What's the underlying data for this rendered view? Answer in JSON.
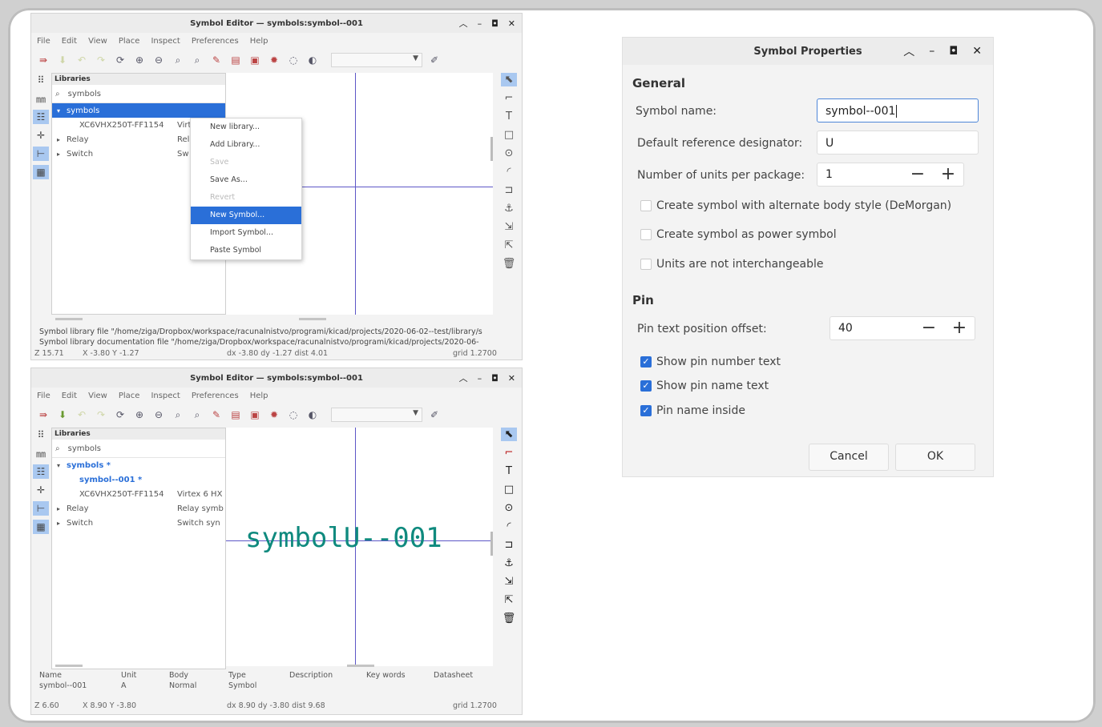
{
  "top_window": {
    "title": "Symbol Editor — symbols:symbol--001",
    "menu": [
      "File",
      "Edit",
      "View",
      "Place",
      "Inspect",
      "Preferences",
      "Help"
    ],
    "libraries_header": "Libraries",
    "search_value": "symbols",
    "tree": [
      {
        "name": "symbols",
        "desc": "",
        "selected": true,
        "arrow": "▾"
      },
      {
        "name": "XC6VHX250T-FF1154",
        "desc": "Virt",
        "selected": false,
        "arrow": ""
      },
      {
        "name": "Relay",
        "desc": "Rel",
        "selected": false,
        "arrow": "▸"
      },
      {
        "name": "Switch",
        "desc": "Sw",
        "selected": false,
        "arrow": "▸"
      }
    ],
    "context_menu": [
      {
        "label": "New library...",
        "state": "normal"
      },
      {
        "label": "Add Library...",
        "state": "normal"
      },
      {
        "label": "Save",
        "state": "disabled"
      },
      {
        "label": "Save As...",
        "state": "normal"
      },
      {
        "label": "Revert",
        "state": "disabled"
      },
      {
        "label": "New Symbol...",
        "state": "highlight"
      },
      {
        "label": "Import Symbol...",
        "state": "normal"
      },
      {
        "label": "Paste Symbol",
        "state": "normal"
      }
    ],
    "msg1": "Symbol library file \"/home/ziga/Dropbox/workspace/racunalnistvo/programi/kicad/projects/2020-06-02--test/library/s",
    "msg2": "Symbol library documentation file \"/home/ziga/Dropbox/workspace/racunalnistvo/programi/kicad/projects/2020-06-",
    "status": {
      "z": "Z 15.71",
      "xy": "X -3.80  Y -1.27",
      "d": "dx -3.80  dy -1.27  dist 4.01",
      "grid": "grid 1.2700"
    }
  },
  "bottom_window": {
    "title": "Symbol Editor — symbols:symbol--001",
    "menu": [
      "File",
      "Edit",
      "View",
      "Place",
      "Inspect",
      "Preferences",
      "Help"
    ],
    "libraries_header": "Libraries",
    "search_value": "symbols",
    "tree": [
      {
        "name": "symbols *",
        "desc": "",
        "bold": true,
        "arrow": "▾",
        "indent": 0
      },
      {
        "name": "symbol--001 *",
        "desc": "",
        "bold": true,
        "arrow": "",
        "indent": 1
      },
      {
        "name": "XC6VHX250T-FF1154",
        "desc": "Virtex 6 HX",
        "bold": false,
        "arrow": "",
        "indent": 1
      },
      {
        "name": "Relay",
        "desc": "Relay symb",
        "bold": false,
        "arrow": "▸",
        "indent": 0
      },
      {
        "name": "Switch",
        "desc": "Switch syn",
        "bold": false,
        "arrow": "▸",
        "indent": 0
      }
    ],
    "canvas_text": "symbolU--001",
    "info_headers": [
      "Name",
      "Unit",
      "Body",
      "Type",
      "Description",
      "Key words",
      "Datasheet"
    ],
    "info_values": [
      "symbol--001",
      "A",
      "Normal",
      "Symbol",
      "",
      "",
      ""
    ],
    "status": {
      "z": "Z 6.60",
      "xy": "X 8.90  Y -3.80",
      "d": "dx 8.90  dy -3.80  dist 9.68",
      "grid": "grid 1.2700"
    }
  },
  "props": {
    "title": "Symbol Properties",
    "general": "General",
    "name_label": "Symbol name:",
    "name_value": "symbol--001",
    "ref_label": "Default reference designator:",
    "ref_value": "U",
    "units_label": "Number of units per package:",
    "units_value": "1",
    "chk_demorgan": "Create symbol with alternate body style (DeMorgan)",
    "chk_power": "Create symbol as power symbol",
    "chk_units": "Units are not interchangeable",
    "pin": "Pin",
    "offset_label": "Pin text position offset:",
    "offset_value": "40",
    "chk_num": "Show pin number text",
    "chk_pname": "Show pin name text",
    "chk_inside": "Pin name inside",
    "cancel": "Cancel",
    "ok": "OK",
    "accent": "#2a6fd8"
  }
}
